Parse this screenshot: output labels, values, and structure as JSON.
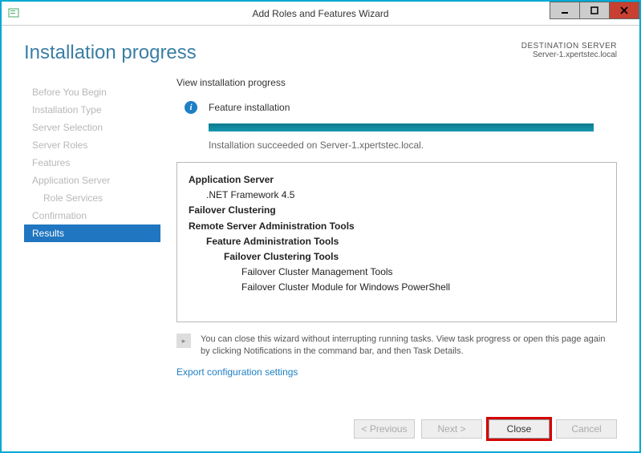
{
  "titlebar": {
    "title": "Add Roles and Features Wizard"
  },
  "header": {
    "page_title": "Installation progress",
    "dest_label": "DESTINATION SERVER",
    "dest_server": "Server-1.xpertstec.local"
  },
  "sidebar": {
    "items": [
      {
        "label": "Before You Begin"
      },
      {
        "label": "Installation Type"
      },
      {
        "label": "Server Selection"
      },
      {
        "label": "Server Roles"
      },
      {
        "label": "Features"
      },
      {
        "label": "Application Server"
      },
      {
        "label": "Role Services"
      },
      {
        "label": "Confirmation"
      },
      {
        "label": "Results"
      }
    ]
  },
  "main": {
    "heading": "View installation progress",
    "info_text": "Feature installation",
    "status_text": "Installation succeeded on Server-1.xpertstec.local.",
    "results": {
      "line0": "Application Server",
      "line1": ".NET Framework 4.5",
      "line2": "Failover Clustering",
      "line3": "Remote Server Administration Tools",
      "line4": "Feature Administration Tools",
      "line5": "Failover Clustering Tools",
      "line6": "Failover Cluster Management Tools",
      "line7": "Failover Cluster Module for Windows PowerShell"
    },
    "hint": "You can close this wizard without interrupting running tasks. View task progress or open this page again by clicking Notifications in the command bar, and then Task Details.",
    "export_link": "Export configuration settings"
  },
  "footer": {
    "previous": "< Previous",
    "next": "Next >",
    "close": "Close",
    "cancel": "Cancel"
  }
}
